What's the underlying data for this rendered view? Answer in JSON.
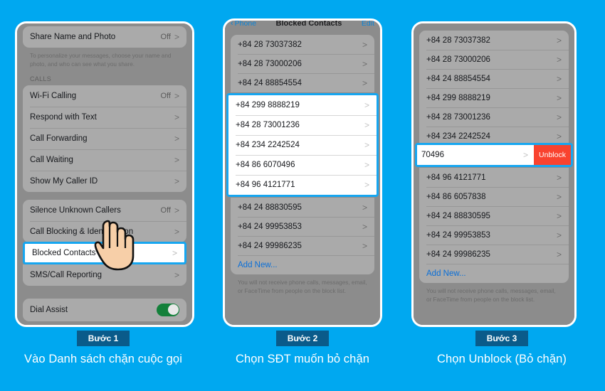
{
  "background_color": "#00a8f0",
  "accent_highlight": "#16a6f0",
  "badge_color": "#0a5b8a",
  "unblock_color": "#f9432f",
  "toggle_on_color": "#13803a",
  "panel1": {
    "name": "iphone-phone-settings",
    "rows_top": [
      {
        "label": "Share Name and Photo",
        "value": "Off",
        "chevron": ">"
      }
    ],
    "note": "To personalize your messages, choose your name and photo, and who can see what you share.",
    "group_head": "CALLS",
    "rows_calls": [
      {
        "label": "Wi-Fi Calling",
        "value": "Off",
        "chevron": ">"
      },
      {
        "label": "Respond with Text",
        "value": "",
        "chevron": ">"
      },
      {
        "label": "Call Forwarding",
        "value": "",
        "chevron": ">"
      },
      {
        "label": "Call Waiting",
        "value": "",
        "chevron": ">"
      },
      {
        "label": "Show My Caller ID",
        "value": "",
        "chevron": ">"
      }
    ],
    "rows_blocking": [
      {
        "label": "Silence Unknown Callers",
        "value": "Off",
        "chevron": ">"
      },
      {
        "label": "Call Blocking & Identification",
        "value": "",
        "chevron": ">"
      }
    ],
    "highlighted_row": {
      "label": "Blocked Contacts",
      "value": "",
      "chevron": ">"
    },
    "rows_after_highlight": [
      {
        "label": "SMS/Call Reporting",
        "value": "",
        "chevron": ">"
      }
    ],
    "rows_dial": [
      {
        "label": "Dial Assist",
        "toggle": "on"
      }
    ]
  },
  "panel2": {
    "name": "blocked-contacts-list",
    "navbar": {
      "back_label": "Phone",
      "title": "Blocked Contacts",
      "action": "Edit"
    },
    "rows_top": [
      "+84 28 73037382",
      "+84 28 73000206",
      "+84 24 88854554"
    ],
    "rows_highlighted": [
      "+84 299 8888219",
      "+84 28 73001236",
      "+84 234 2242524",
      "+84 86 6070496",
      "+84 96 4121771"
    ],
    "rows_bottom": [
      "+84 24 88830595",
      "+84 24 99953853",
      "+84 24 99986235"
    ],
    "add_new": "Add New...",
    "footer": "You will not receive phone calls, messages, email, or FaceTime from people on the block list.",
    "chevron": ">"
  },
  "panel3": {
    "name": "blocked-contacts-unblock",
    "rows_top": [
      "+84 28 73037382",
      "+84 28 73000206",
      "+84 24 88854554",
      "+84 299 8888219",
      "+84 28 73001236",
      "+84 234 2242524"
    ],
    "swipe_row": {
      "label": "70496",
      "chevron": ">",
      "button": "Unblock"
    },
    "rows_bottom": [
      "+84 96 4121771",
      "+84 86 6057838",
      "+84 24 88830595",
      "+84 24 99953853",
      "+84 24 99986235"
    ],
    "add_new": "Add New...",
    "footer": "You will not receive phone calls, messages, email, or FaceTime from people on the block list.",
    "chevron": ">"
  },
  "steps": [
    {
      "badge": "Bước 1",
      "caption": "Vào Danh sách chặn cuộc gọi"
    },
    {
      "badge": "Bước 2",
      "caption": "Chọn SĐT muốn bỏ chặn"
    },
    {
      "badge": "Bước 3",
      "caption": "Chọn Unblock (Bỏ chặn)"
    }
  ]
}
